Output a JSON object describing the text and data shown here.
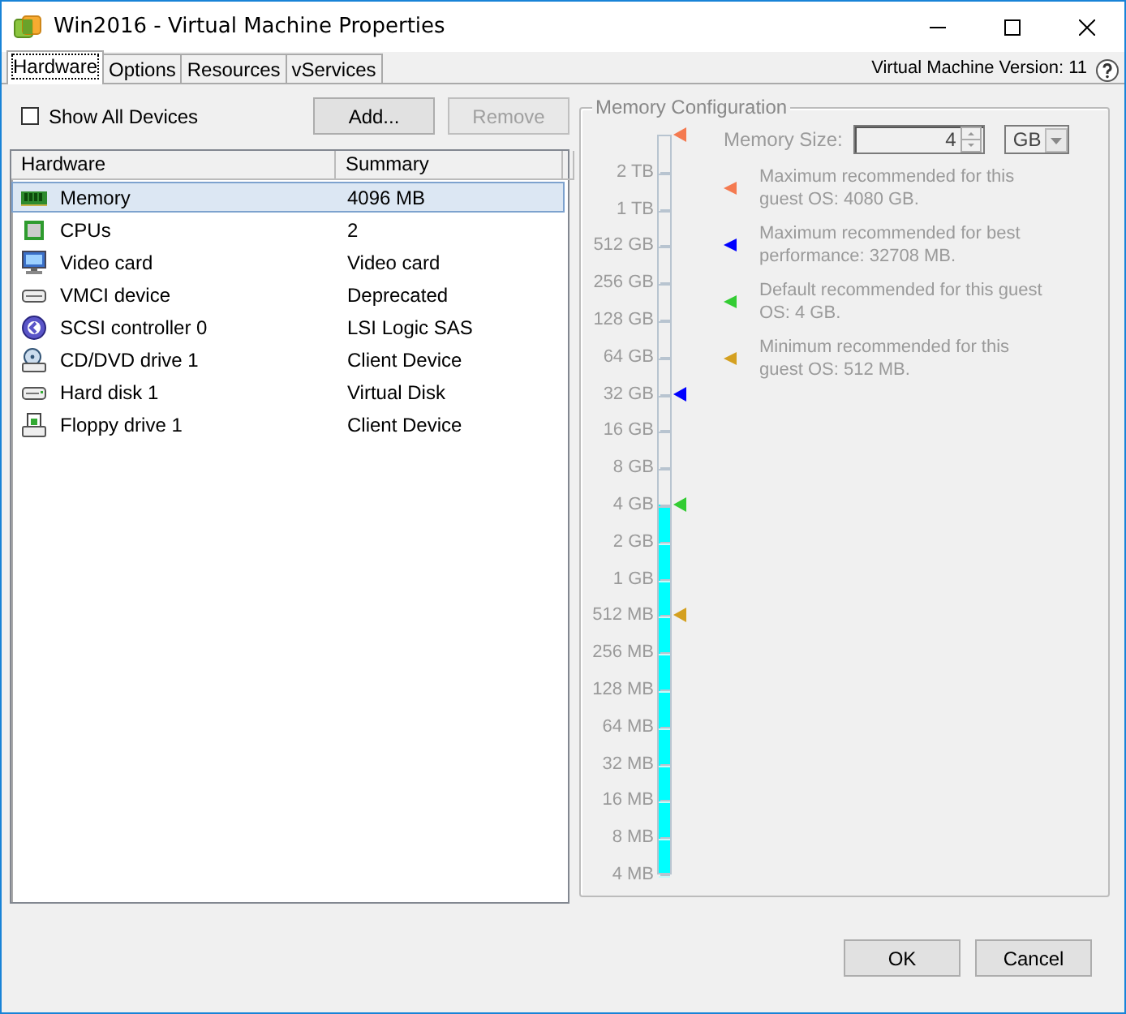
{
  "window": {
    "title": "Win2016 - Virtual Machine Properties"
  },
  "tabs": [
    {
      "label": "Hardware",
      "selected": true
    },
    {
      "label": "Options",
      "selected": false
    },
    {
      "label": "Resources",
      "selected": false
    },
    {
      "label": "vServices",
      "selected": false
    }
  ],
  "version": "Virtual Machine Version: 11",
  "hardware_panel": {
    "show_all_devices": {
      "label": "Show All Devices",
      "checked": false
    },
    "buttons": [
      {
        "label": "Add...",
        "disabled": false
      },
      {
        "label": "Remove",
        "disabled": true
      }
    ],
    "columns": [
      "Hardware",
      "Summary"
    ],
    "rows": [
      {
        "kind": "memory",
        "name": "Memory",
        "summary": "4096 MB",
        "selected": true
      },
      {
        "kind": "cpu",
        "name": "CPUs",
        "summary": "2",
        "selected": false
      },
      {
        "kind": "display",
        "name": "Video card",
        "summary": "Video card",
        "selected": false
      },
      {
        "kind": "device",
        "name": "VMCI device",
        "summary": "Deprecated",
        "selected": false
      },
      {
        "kind": "controller",
        "name": "SCSI controller 0",
        "summary": "LSI Logic SAS",
        "selected": false
      },
      {
        "kind": "cdrom",
        "name": "CD/DVD drive 1",
        "summary": "Client Device",
        "selected": false
      },
      {
        "kind": "disk",
        "name": "Hard disk 1",
        "summary": "Virtual Disk",
        "selected": false
      },
      {
        "kind": "floppy",
        "name": "Floppy drive 1",
        "summary": "Client Device",
        "selected": false
      }
    ]
  },
  "memory_config": {
    "title": "Memory Configuration",
    "disabled": true,
    "scale_labels": [
      "2 TB",
      "1 TB",
      "512 GB",
      "256 GB",
      "128 GB",
      "64 GB",
      "32 GB",
      "16 GB",
      "8 GB",
      "4 GB",
      "2 GB",
      "1 GB",
      "512 MB",
      "256 MB",
      "128 MB",
      "64 MB",
      "32 MB",
      "16 MB",
      "8 MB",
      "4 MB"
    ],
    "level": 0.5,
    "memory_size": {
      "label": "Memory Size:",
      "value": "4",
      "unit": "GB"
    },
    "recommendations": [
      {
        "text": "Maximum recommended for this guest OS: 4080 GB.",
        "color": "#f47a50",
        "level": 1
      },
      {
        "text": "Maximum recommended for best performance: 32708 MB.",
        "color": "#0000ff",
        "level": 0.65
      },
      {
        "text": "Default recommended for this guest OS: 4 GB.",
        "color": "#33cc33",
        "level": 0.5
      },
      {
        "text": "Minimum recommended for this guest OS: 512 MB.",
        "color": "#d4a020",
        "level": 0.35
      }
    ]
  },
  "footer_buttons": [
    "OK",
    "Cancel"
  ]
}
